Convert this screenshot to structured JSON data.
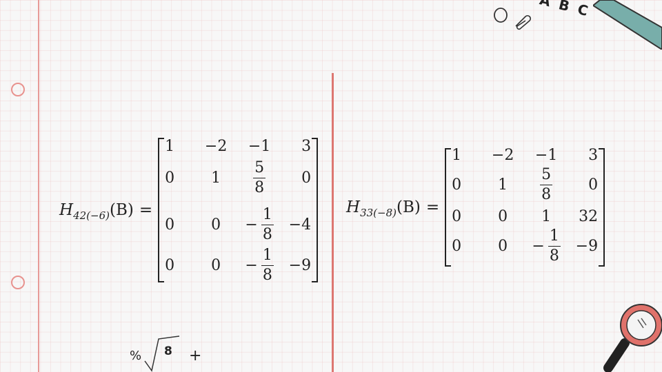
{
  "left_equation": {
    "symbol": "H",
    "subscript": "42(−6)",
    "argument": "(B)",
    "equals": "=",
    "rows": [
      [
        {
          "t": "1"
        },
        {
          "t": "−2"
        },
        {
          "t": "−1"
        },
        {
          "t": "3"
        }
      ],
      [
        {
          "t": "0"
        },
        {
          "t": "1"
        },
        {
          "num": "5",
          "den": "8"
        },
        {
          "t": "0"
        }
      ],
      [
        {
          "t": "0"
        },
        {
          "t": "0"
        },
        {
          "sign": "−",
          "num": "1",
          "den": "8"
        },
        {
          "t": "−4"
        }
      ],
      [
        {
          "t": "0"
        },
        {
          "t": "0"
        },
        {
          "sign": "−",
          "num": "1",
          "den": "8"
        },
        {
          "t": "−9"
        }
      ]
    ]
  },
  "right_equation": {
    "symbol": "H",
    "subscript": "33(−8)",
    "argument": "(B)",
    "equals": "=",
    "rows": [
      [
        {
          "t": "1"
        },
        {
          "t": "−2"
        },
        {
          "t": "−1"
        },
        {
          "t": "3"
        }
      ],
      [
        {
          "t": "0"
        },
        {
          "t": "1"
        },
        {
          "num": "5",
          "den": "8"
        },
        {
          "t": "0"
        }
      ],
      [
        {
          "t": "0"
        },
        {
          "t": "0"
        },
        {
          "t": "1"
        },
        {
          "t": "32"
        }
      ],
      [
        {
          "t": "0"
        },
        {
          "t": "0"
        },
        {
          "sign": "−",
          "num": "1",
          "den": "8"
        },
        {
          "t": "−9"
        }
      ]
    ]
  },
  "decorations": {
    "abc_text": "A B C",
    "percent_text": "%",
    "sqrt_number": "8",
    "plus_text": "+"
  },
  "colors": {
    "grid_line": "#f0cccc",
    "margin_line": "#e79a97",
    "divider": "#dd7771",
    "ruler": "#78aeaa",
    "magnifier_ring": "#e0726b"
  }
}
